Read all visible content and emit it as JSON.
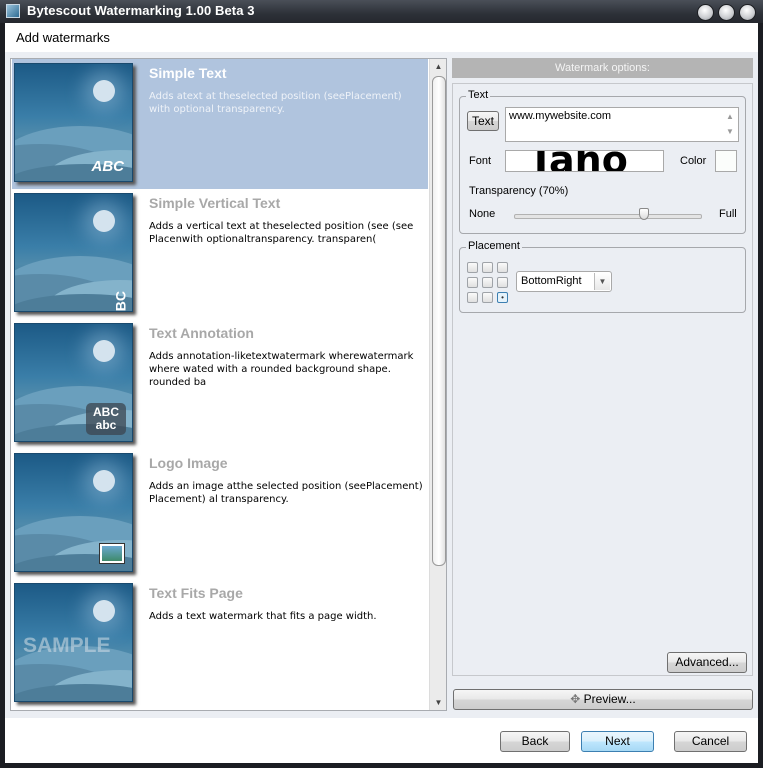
{
  "window": {
    "title": "Bytescout Watermarking 1.00 Beta 3",
    "controls": [
      "minimize",
      "maximize",
      "close"
    ]
  },
  "header": {
    "title": "Add watermarks"
  },
  "list": {
    "items": [
      {
        "title": "Simple Text",
        "description": "Adds atext at theselected position (seePlacement) with optional transparency.",
        "watermark": "ABC",
        "selected": true
      },
      {
        "title": "Simple Vertical Text",
        "description": "Adds a vertical text at theselected position (see (see Placenwith optionaltransparency. transparen(",
        "watermark": "ABC",
        "selected": false
      },
      {
        "title": "Text Annotation",
        "description": "Adds annotation-liketextwatermark wherewatermark where wated with a rounded background shape. rounded ba",
        "watermark_line1": "ABC",
        "watermark_line2": "abc",
        "selected": false
      },
      {
        "title": "Logo Image",
        "description": "Adds an image atthe selected position (seePlacement) Placement) al transparency.",
        "watermark": "image-icon",
        "selected": false
      },
      {
        "title": "Text Fits Page",
        "description": "Adds a text watermark that fits a page width.",
        "watermark": "SAMPLE",
        "selected": false
      }
    ]
  },
  "options": {
    "header": "Watermark options:",
    "text_group": {
      "label": "Text",
      "text_button": "Text",
      "text_value": "www.mywebsite.com",
      "font_label": "Font",
      "font_preview": "Taho",
      "color_label": "Color",
      "color_value": "#fbfdfb",
      "transparency_label": "Transparency (70%)",
      "transparency_value": 70,
      "slider_min_label": "None",
      "slider_max_label": "Full"
    },
    "placement_group": {
      "label": "Placement",
      "grid_selected": "bottom-right",
      "selected_value": "BottomRight"
    },
    "advanced_button": "Advanced...",
    "preview_button": "Preview..."
  },
  "footer": {
    "back": "Back",
    "next": "Next",
    "cancel": "Cancel"
  }
}
